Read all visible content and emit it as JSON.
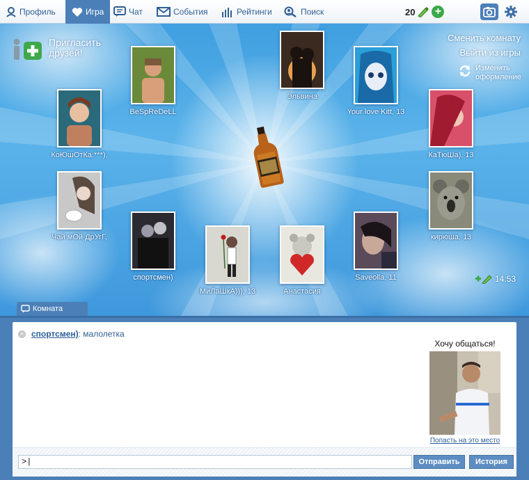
{
  "nav": {
    "items": [
      {
        "label": "Профиль",
        "icon": "profile-icon"
      },
      {
        "label": "Игра",
        "icon": "heart-icon",
        "active": true
      },
      {
        "label": "Чат",
        "icon": "chat-icon"
      },
      {
        "label": "События",
        "icon": "envelope-icon"
      },
      {
        "label": "Рейтинги",
        "icon": "bar-chart-icon"
      },
      {
        "label": "Поиск",
        "icon": "search-icon"
      }
    ],
    "coins": "20",
    "coin_icon": "pencil-coin-icon"
  },
  "game": {
    "invite_text": "Пригласить друзей!",
    "change_room": "Сменить комнату",
    "exit_game": "Выйти из игры",
    "change_theme": "Изменить оформление",
    "timer": "14:53",
    "room_tab": "Комната",
    "bottle_icon": "whiskey-bottle-icon",
    "players": [
      {
        "name": "BeSpReDeLL",
        "colors": [
          "#6a8a3a",
          "#d8a07a"
        ]
      },
      {
        "name": "Эльвина",
        "colors": [
          "#3a2a20",
          "#e8a050"
        ]
      },
      {
        "name": "Your love Kitt, 13",
        "colors": [
          "#2a9fd8",
          "#1a3a6a"
        ]
      },
      {
        "name": "КоЮшОтКа:***),",
        "colors": [
          "#2a6a7a",
          "#c08060"
        ]
      },
      {
        "name": "КаТюШа), 13",
        "colors": [
          "#d8506a",
          "#f0c8b8"
        ]
      },
      {
        "name": "Чай мОй  ДрУгГ,",
        "colors": [
          "#c8c8c8",
          "#5a4a40"
        ]
      },
      {
        "name": "кирюша, 13",
        "colors": [
          "#8a8a7a",
          "#4a4a40"
        ]
      },
      {
        "name": "спортсмен)",
        "colors": [
          "#2a2a30",
          "#9a9aa8"
        ]
      },
      {
        "name": "МиЛаШкА))), 13",
        "colors": [
          "#d8d8d0",
          "#6a4a40"
        ]
      },
      {
        "name": "Анастасия",
        "colors": [
          "#e8e8e0",
          "#d02828"
        ]
      },
      {
        "name": "Saveolla, 11",
        "colors": [
          "#5a4a5a",
          "#c8a898"
        ]
      }
    ]
  },
  "chat": {
    "message_author": "спортсмен)",
    "message_text": ": малолетка",
    "featured_title": "Хочу общаться!",
    "featured_link": "Попасть на это место",
    "input_value": ">|",
    "send_label": "Отправить",
    "history_label": "История"
  }
}
